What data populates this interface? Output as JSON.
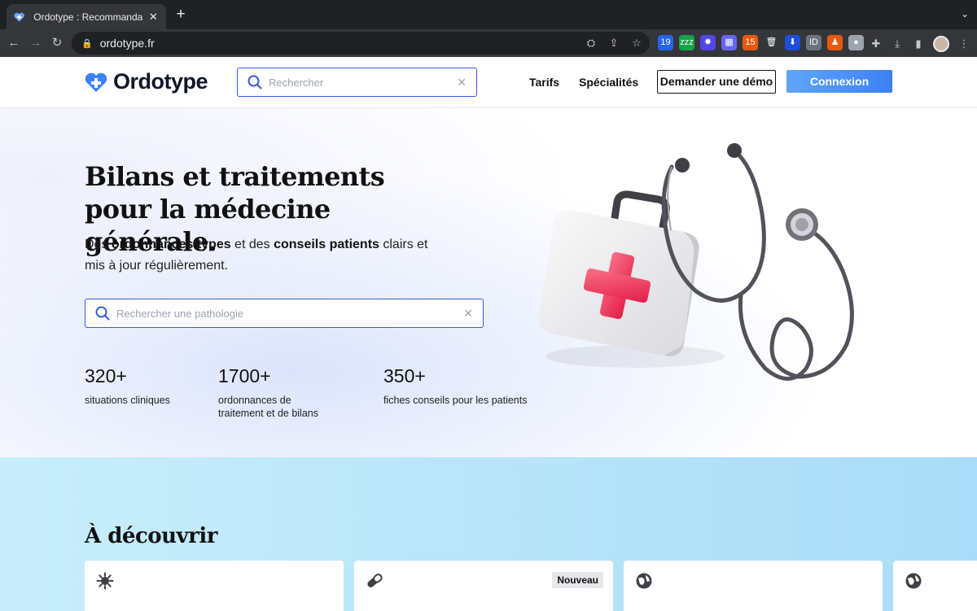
{
  "browser": {
    "tab_title": "Ordotype : Recommandations,",
    "tab_close": "✕",
    "new_tab": "+",
    "url": "ordotype.fr",
    "extensions": [
      {
        "name": "ext-weather",
        "label": "19",
        "color": "#2563eb"
      },
      {
        "name": "ext-zzz",
        "label": "zzz",
        "color": "#16a34a"
      },
      {
        "name": "ext-spark",
        "label": "✸",
        "color": "#4f46e5"
      },
      {
        "name": "ext-grid",
        "label": "▦",
        "color": "#6366f1"
      },
      {
        "name": "ext-counter",
        "label": "15",
        "color": "#ea580c"
      },
      {
        "name": "ext-trash",
        "label": "🗑",
        "color": "#35363a"
      },
      {
        "name": "ext-download",
        "label": "⬇",
        "color": "#1d4ed8"
      },
      {
        "name": "ext-ublock",
        "label": "ID",
        "color": "#6b7280"
      },
      {
        "name": "ext-chess",
        "label": "♟",
        "color": "#ea580c"
      },
      {
        "name": "ext-circle",
        "label": "●",
        "color": "#9ca3af"
      }
    ]
  },
  "header": {
    "logo_text": "Ordotype",
    "search_placeholder": "Rechercher",
    "nav": {
      "pricing": "Tarifs",
      "specialties": "Spécialités"
    },
    "demo_button": "Demander une démo",
    "login_button": "Connexion"
  },
  "hero": {
    "title": "Bilans et traitements pour la médecine générale.",
    "subtitle_parts": {
      "p1": "Des ",
      "b1": "ordonnances types",
      "p2": " et des ",
      "b2": "conseils patients",
      "p3": " clairs et mis à jour régulièrement."
    },
    "search_placeholder": "Rechercher une pathologie",
    "stats": [
      {
        "value": "320+",
        "label": "situations cliniques"
      },
      {
        "value": "1700+",
        "label": "ordonnances de traitement et de bilans"
      },
      {
        "value": "350+",
        "label": "fiches conseils pour les patients"
      }
    ]
  },
  "discover": {
    "title": "À découvrir",
    "cards": [
      {
        "icon": "virus-icon",
        "badge": ""
      },
      {
        "icon": "pill-icon",
        "badge": "Nouveau"
      },
      {
        "icon": "globe-icon",
        "badge": ""
      },
      {
        "icon": "globe-icon",
        "badge": ""
      }
    ]
  },
  "colors": {
    "accent": "#3b5bdb",
    "brand_blue": "#3b82f6",
    "cross_red": "#f43f5e"
  }
}
